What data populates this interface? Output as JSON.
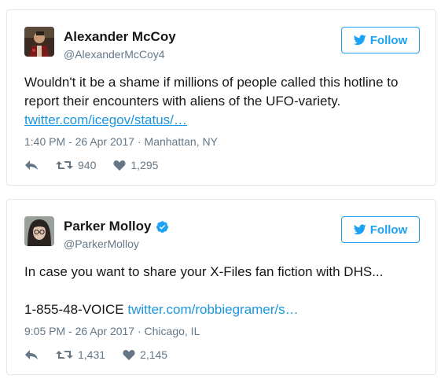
{
  "tweets": [
    {
      "name": "Alexander McCoy",
      "handle": "@AlexanderMcCoy4",
      "verified": false,
      "follow_label": "Follow",
      "text": "Wouldn't it be a shame if millions of people called this hotline to report their encounters with aliens of the UFO-variety.",
      "link": "twitter.com/icegov/status/…",
      "meta": "1:40 PM - 26 Apr 2017 · Manhattan, NY",
      "retweets": "940",
      "likes": "1,295"
    },
    {
      "name": "Parker Molloy",
      "handle": "@ParkerMolloy",
      "verified": true,
      "follow_label": "Follow",
      "text": "In case you want to share your X-Files fan fiction with DHS...",
      "phone": "1-855-48-VOICE",
      "link": "twitter.com/robbiegramer/s…",
      "meta": "9:05 PM - 26 Apr 2017 · Chicago, IL",
      "retweets": "1,431",
      "likes": "2,145"
    }
  ],
  "colors": {
    "accent": "#1da1f2",
    "link": "#1b95e0",
    "muted": "#657786",
    "border": "#e1e8ed"
  },
  "icons": [
    "reply-icon",
    "retweet-icon",
    "like-icon",
    "twitter-bird-icon",
    "verified-badge-icon"
  ]
}
